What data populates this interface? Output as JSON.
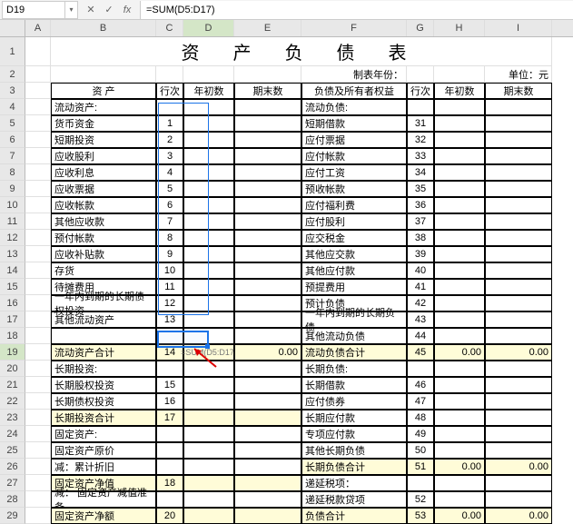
{
  "formula_bar": {
    "cell_ref": "D19",
    "formula": "=SUM(D5:D17)"
  },
  "col_headers": [
    "A",
    "B",
    "C",
    "D",
    "E",
    "F",
    "G",
    "H",
    "I"
  ],
  "title": "资 产 负 债 表",
  "meta": {
    "year_label": "制表年份：",
    "unit": "单位：元"
  },
  "header": {
    "assets": "资  产",
    "row_no": "行次",
    "begin": "年初数",
    "end": "期末数",
    "liab": "负债及所有者权益"
  },
  "rows_left": [
    {
      "b": "流动资产:",
      "c": "",
      "hl": false
    },
    {
      "b": "货币资金",
      "c": "1",
      "hl": false
    },
    {
      "b": "短期投资",
      "c": "2",
      "hl": false
    },
    {
      "b": "应收股利",
      "c": "3",
      "hl": false
    },
    {
      "b": "应收利息",
      "c": "4",
      "hl": false
    },
    {
      "b": "应收票据",
      "c": "5",
      "hl": false
    },
    {
      "b": "应收帐款",
      "c": "6",
      "hl": false
    },
    {
      "b": "其他应收款",
      "c": "7",
      "hl": false
    },
    {
      "b": "预付帐款",
      "c": "8",
      "hl": false
    },
    {
      "b": "应收补贴款",
      "c": "9",
      "hl": false
    },
    {
      "b": "存货",
      "c": "10",
      "hl": false
    },
    {
      "b": "待摊费用",
      "c": "11",
      "hl": false
    },
    {
      "b": "一年内到期的长期债权投资",
      "c": "12",
      "hl": false
    },
    {
      "b": "其他流动资产",
      "c": "13",
      "hl": false
    },
    {
      "b": "",
      "c": "",
      "hl": false
    },
    {
      "b": "流动资产合计",
      "c": "14",
      "hl": true,
      "d": "=SUM(D5:D17)",
      "e": "0.00"
    },
    {
      "b": "长期投资:",
      "c": "",
      "hl": false
    },
    {
      "b": "长期股权投资",
      "c": "15",
      "hl": false
    },
    {
      "b": "长期债权投资",
      "c": "16",
      "hl": false
    },
    {
      "b": "长期投资合计",
      "c": "17",
      "hl": true,
      "d": "",
      "e": ""
    },
    {
      "b": "固定资产:",
      "c": "",
      "hl": false
    },
    {
      "b": "固定资产原价",
      "c": "",
      "hl": false
    },
    {
      "b": "减：累计折旧",
      "c": "",
      "hl": false
    },
    {
      "b": "固定资产净值",
      "c": "18",
      "hl": true
    },
    {
      "b": "减： 固定资产减值准备",
      "c": "",
      "hl": false
    },
    {
      "b": "固定资产净额",
      "c": "20",
      "hl": true
    }
  ],
  "rows_right": [
    {
      "f": "流动负债:",
      "g": ""
    },
    {
      "f": "短期借款",
      "g": "31"
    },
    {
      "f": "应付票据",
      "g": "32"
    },
    {
      "f": "应付帐款",
      "g": "33"
    },
    {
      "f": "应付工资",
      "g": "34"
    },
    {
      "f": "预收帐款",
      "g": "35"
    },
    {
      "f": "应付福利费",
      "g": "36"
    },
    {
      "f": "应付股利",
      "g": "37"
    },
    {
      "f": "应交税金",
      "g": "38"
    },
    {
      "f": "其他应交款",
      "g": "39"
    },
    {
      "f": "其他应付款",
      "g": "40"
    },
    {
      "f": "预提费用",
      "g": "41"
    },
    {
      "f": "预计负债",
      "g": "42"
    },
    {
      "f": "一年内到期的长期负债",
      "g": "43"
    },
    {
      "f": "其他流动负债",
      "g": "44"
    },
    {
      "f": "流动负债合计",
      "g": "45",
      "hl": true,
      "h": "0.00",
      "i": "0.00"
    },
    {
      "f": "长期负债:",
      "g": ""
    },
    {
      "f": "长期借款",
      "g": "46"
    },
    {
      "f": "应付债券",
      "g": "47"
    },
    {
      "f": "长期应付款",
      "g": "48"
    },
    {
      "f": "专项应付款",
      "g": "49"
    },
    {
      "f": "其他长期负债",
      "g": "50"
    },
    {
      "f": "长期负债合计",
      "g": "51",
      "hl": true,
      "h": "0.00",
      "i": "0.00"
    },
    {
      "f": "递延税项：",
      "g": ""
    },
    {
      "f": "递延税款贷项",
      "g": "52"
    },
    {
      "f": "负债合计",
      "g": "53",
      "hl": true,
      "h": "0.00",
      "i": "0.00"
    }
  ],
  "active_col": "D",
  "active_row": 19
}
